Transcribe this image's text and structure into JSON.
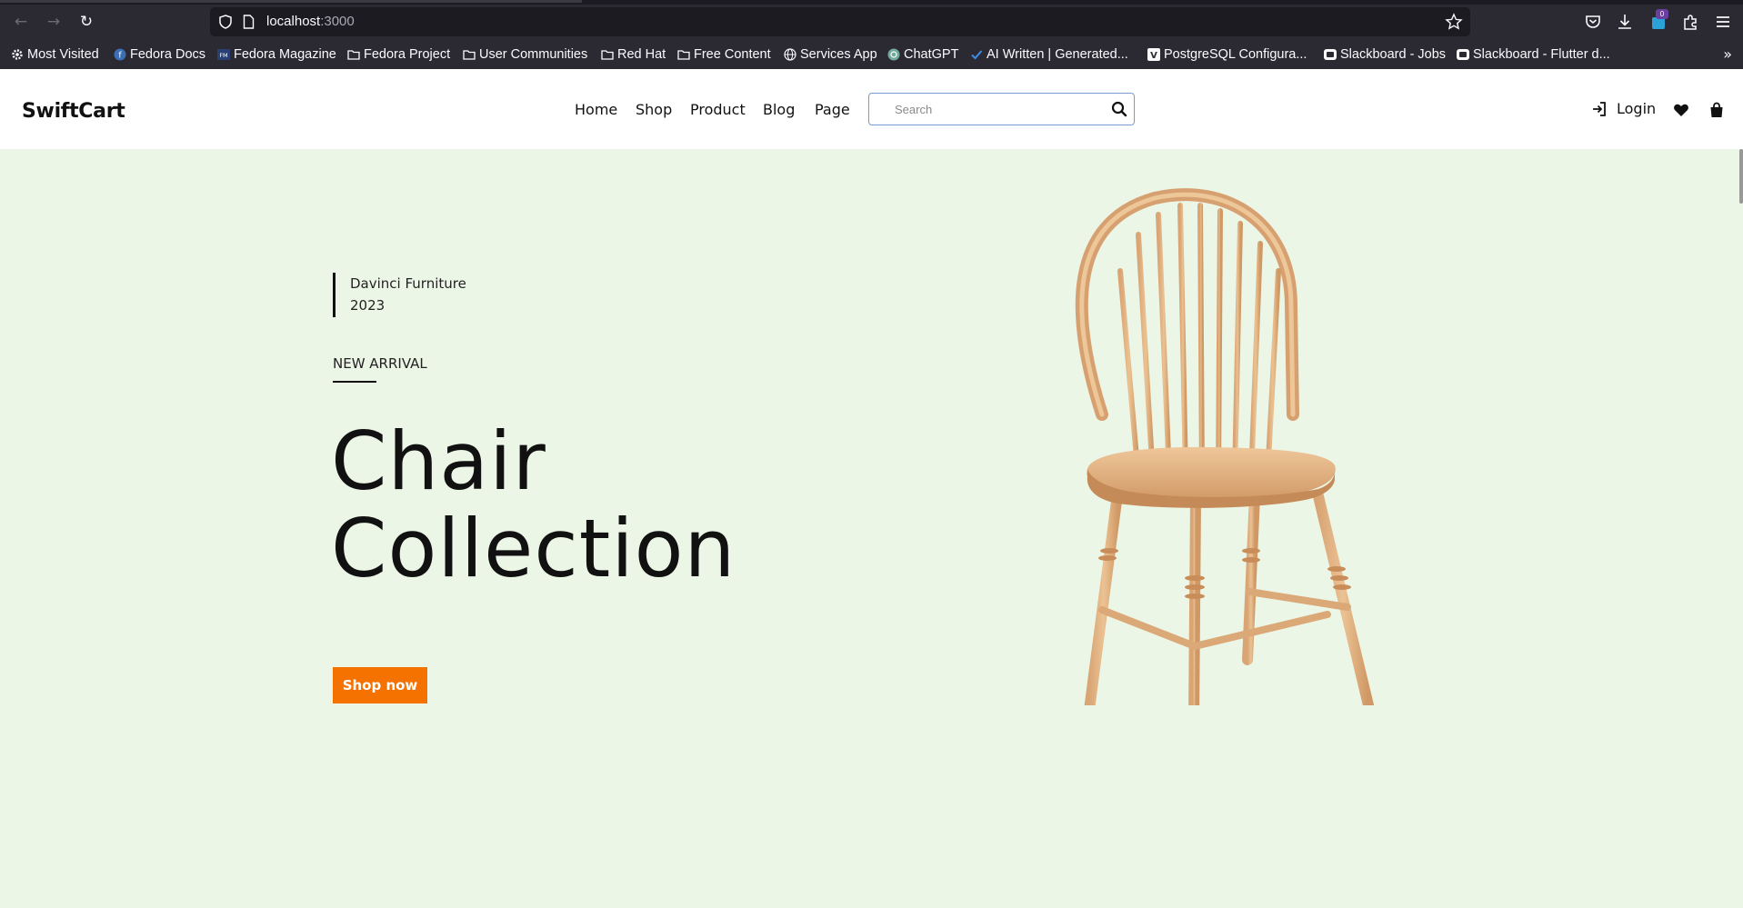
{
  "browser": {
    "url_host": "localhost",
    "url_port": ":3000",
    "extension_badge": "0",
    "bookmarks": [
      {
        "label": "Most Visited",
        "icon": "gear-icon"
      },
      {
        "label": "Fedora Docs",
        "icon": "fedora-icon"
      },
      {
        "label": "Fedora Magazine",
        "icon": "fedora-magazine-icon"
      },
      {
        "label": "Fedora Project",
        "icon": "folder-icon"
      },
      {
        "label": "User Communities",
        "icon": "folder-icon"
      },
      {
        "label": "Red Hat",
        "icon": "folder-icon"
      },
      {
        "label": "Free Content",
        "icon": "folder-icon"
      },
      {
        "label": "Services App",
        "icon": "globe-icon"
      },
      {
        "label": "ChatGPT",
        "icon": "chatgpt-icon"
      },
      {
        "label": "AI Written | Generated...",
        "icon": "check-icon"
      },
      {
        "label": "PostgreSQL Configura...",
        "icon": "v-icon"
      },
      {
        "label": "Slackboard - Jobs",
        "icon": "slackboard-icon"
      },
      {
        "label": "Slackboard - Flutter d...",
        "icon": "slackboard-icon"
      }
    ]
  },
  "site": {
    "logo": "SwiftCart",
    "nav": [
      "Home",
      "Shop",
      "Product",
      "Blog",
      "Page"
    ],
    "search_placeholder": "Search",
    "login_label": "Login"
  },
  "hero": {
    "brand_line1": "Davinci Furniture",
    "brand_line2": "2023",
    "eyebrow": "NEW ARRIVAL",
    "title_line1": "Chair",
    "title_line2": "Collection",
    "cta": "Shop now"
  },
  "colors": {
    "hero_bg": "#ecf6e6",
    "cta_bg": "#f57200",
    "chrome_bg": "#2b2a33"
  }
}
